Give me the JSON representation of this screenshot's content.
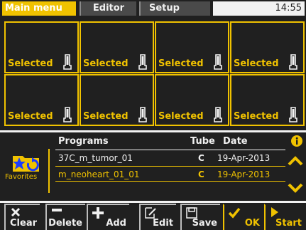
{
  "tabs": [
    {
      "label": "Main menu",
      "active": true
    },
    {
      "label": "Editor",
      "active": false
    },
    {
      "label": "Setup",
      "active": false
    }
  ],
  "clock": "14:55",
  "positions": [
    {
      "label": "Selected"
    },
    {
      "label": "Selected"
    },
    {
      "label": "Selected"
    },
    {
      "label": "Selected"
    },
    {
      "label": "Selected"
    },
    {
      "label": "Selected"
    },
    {
      "label": "Selected"
    },
    {
      "label": "Selected"
    }
  ],
  "favorites": {
    "label": "Favorites",
    "icon": "star-refresh-icon"
  },
  "programs": {
    "headers": {
      "name": "Programs",
      "tube": "Tube",
      "date": "Date"
    },
    "rows": [
      {
        "name": "37C_m_tumor_01",
        "tube": "C",
        "date": "19-Apr-2013",
        "selected": false
      },
      {
        "name": "m_neoheart_01_01",
        "tube": "C",
        "date": "19-Apr-2013",
        "selected": true
      }
    ]
  },
  "toolbar": {
    "clear": "Clear",
    "delete": "Delete",
    "add": "Add",
    "edit": "Edit",
    "save": "Save",
    "ok": "OK",
    "start": "Start"
  },
  "colors": {
    "accent": "#f0c200",
    "background": "#202020",
    "text": "#f0f0f0"
  }
}
